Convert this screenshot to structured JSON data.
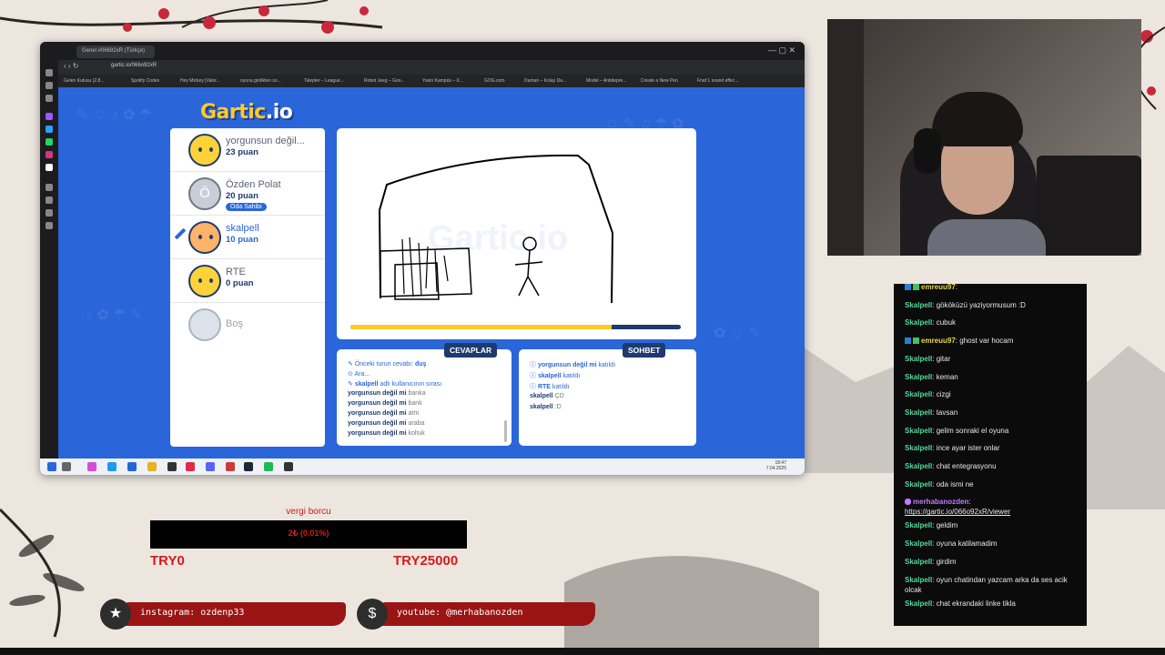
{
  "browser": {
    "tab_title": "Genel #06692xR (Türkçe)",
    "url": "gartic.io/066o92xR",
    "bookmarks": [
      "Gelen Kutusu (2.8...",
      "Spotify Codes",
      "Hey Mickey [Valor...",
      "oyuna girdikten so...",
      "Talepler – League...",
      "Robot Jeeg – Goo...",
      "Yasin Kampüs – X...",
      "GOG.com",
      "Duman – Kolay Da...",
      "Model – Antidepre...",
      "Create a New Pen",
      "Fnaf 1 sound effec..."
    ],
    "taskbar_time": "18:47",
    "taskbar_date": "7.04.2025"
  },
  "game": {
    "logo_main": "Gartic",
    "logo_suffix": ".io",
    "watermark": "Gartic.io",
    "progress_fraction": 0.79,
    "players": [
      {
        "name": "yorgunsun değil...",
        "score": "23 puan",
        "avatar": "yellow"
      },
      {
        "name": "Özden Polat",
        "score": "20 puan",
        "badge": "Oda Sahibi",
        "initial": "Ö",
        "avatar": "grey"
      },
      {
        "name": "skalpell",
        "score": "10 puan",
        "avatar": "girl",
        "drawing": true
      },
      {
        "name": "RTE",
        "score": "0 puan",
        "avatar": "yellow"
      },
      {
        "name": "Boş",
        "score": "",
        "avatar": "empty"
      }
    ],
    "answers_title": "CEVAPLAR",
    "chat_title": "SOHBET",
    "answers": [
      {
        "pre": "Önceki turun cevabı: ",
        "strong": "duş"
      },
      {
        "pre": "Ara...",
        "strong": ""
      },
      {
        "pre": "",
        "strong": "skalpell",
        "post": " adlı kullanıcının sırası"
      },
      {
        "name": "yorgunsun değil mi",
        "text": "banka"
      },
      {
        "name": "yorgunsun değil mi",
        "text": "bank"
      },
      {
        "name": "yorgunsun değil mi",
        "text": "atm"
      },
      {
        "name": "yorgunsun değil mi",
        "text": "araba"
      },
      {
        "name": "yorgunsun değil mi",
        "text": "koltuk"
      }
    ],
    "chat": [
      {
        "name": "yorgunsun değil mi",
        "text": "katıldı"
      },
      {
        "name": "skalpell",
        "text": "katıldı"
      },
      {
        "name": "RTE",
        "text": "katıldı"
      },
      {
        "name": "skalpell",
        "text": "ÇD"
      },
      {
        "name": "skalpell",
        "text": ":D"
      }
    ]
  },
  "stream_chat": [
    {
      "name": "emreuu97",
      "text": "",
      "style": "y"
    },
    {
      "name": "Skalpell",
      "text": "gököküzü yaziyormusum :D"
    },
    {
      "name": "Skalpell",
      "text": "cubuk"
    },
    {
      "name": "emreuu97",
      "text": "ghost var hocam",
      "style": "y"
    },
    {
      "name": "Skalpell",
      "text": "gitar"
    },
    {
      "name": "Skalpell",
      "text": "keman"
    },
    {
      "name": "Skalpell",
      "text": "cizgi"
    },
    {
      "name": "Skalpell",
      "text": "tavsan"
    },
    {
      "name": "Skalpell",
      "text": "gelim sonraki el oyuna"
    },
    {
      "name": "Skalpell",
      "text": "ince ayar ister onlar"
    },
    {
      "name": "Skalpell",
      "text": "chat entegrasyonu"
    },
    {
      "name": "Skalpell",
      "text": "oda ismi ne"
    },
    {
      "name": "merhabanozden",
      "text": "https://gartic.io/066o92xR/viewer",
      "style": "p"
    },
    {
      "name": "Skalpell",
      "text": "geldim"
    },
    {
      "name": "Skalpell",
      "text": "oyuna katilamadim"
    },
    {
      "name": "Skalpell",
      "text": "girdim"
    },
    {
      "name": "Skalpell",
      "text": "oyun chatindan yazcam arka da ses acik olcak"
    },
    {
      "name": "Skalpell",
      "text": "chat ekrandaki linke tikla"
    }
  ],
  "donation": {
    "label": "vergi borcu",
    "current": "2₺ (0.01%)",
    "min": "TRY0",
    "max": "TRY25000"
  },
  "socials": [
    {
      "icon": "star-icon",
      "text": "instagram: ozdenp33"
    },
    {
      "icon": "dollar-icon",
      "text": "youtube: @merhabanozden"
    }
  ],
  "colors": {
    "gartic_blue": "#2a66d9",
    "gartic_navy": "#1e3a6e",
    "gartic_yellow": "#ffc928",
    "chat_green": "#56d99a",
    "donation_red": "#d81a1a"
  }
}
